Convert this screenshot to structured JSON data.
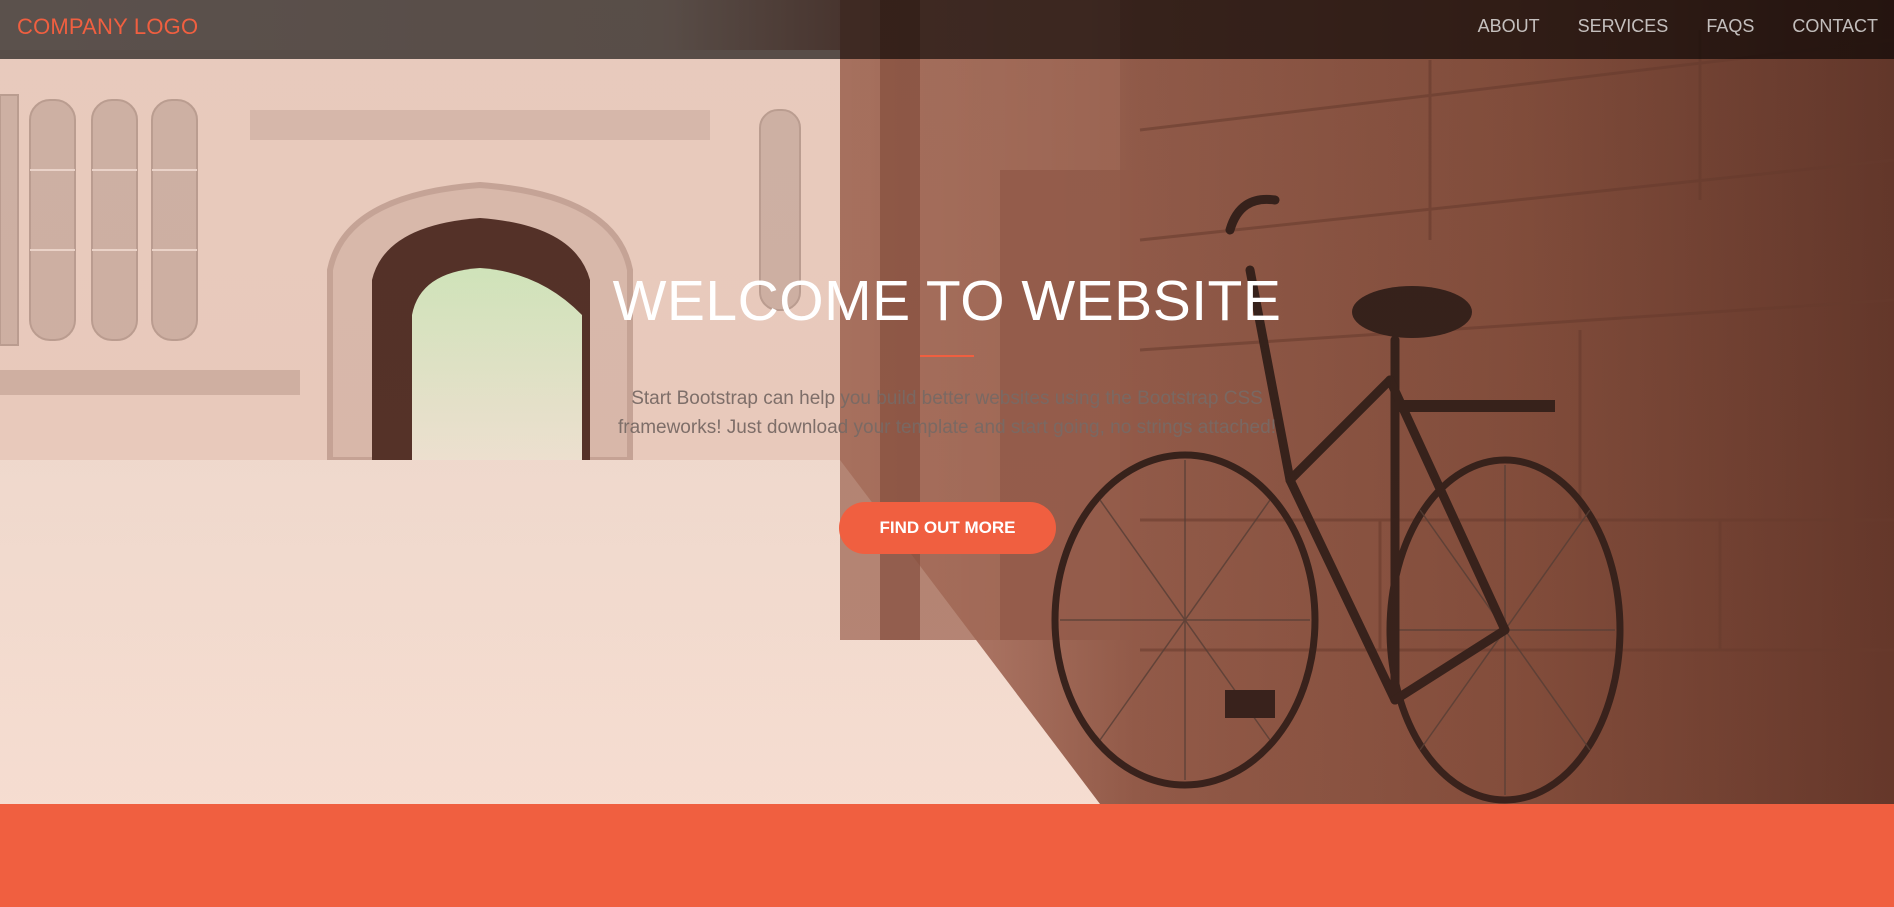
{
  "navbar": {
    "logo": "COMPANY LOGO",
    "links": [
      "ABOUT",
      "SERVICES",
      "FAQS",
      "CONTACT"
    ]
  },
  "hero": {
    "title": "WELCOME TO WEBSITE",
    "text": "Start Bootstrap can help you build better websites using the Bootstrap CSS frameworks! Just download your template and start going, no strings attached!",
    "button_label": "FIND OUT MORE"
  },
  "colors": {
    "accent": "#f05f40",
    "navbar_bg": "rgba(0,0,0,0.62)"
  }
}
